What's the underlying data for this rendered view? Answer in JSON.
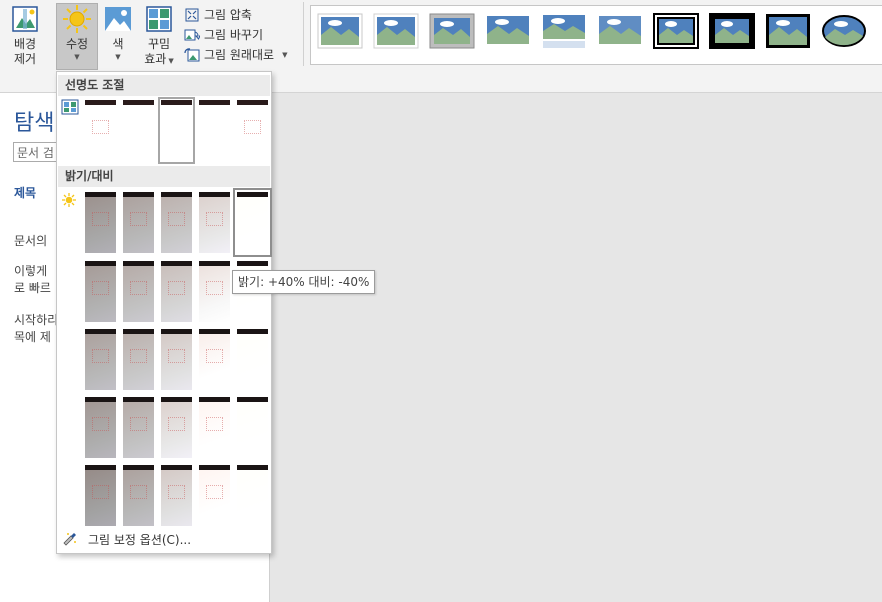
{
  "ribbon": {
    "remove_bg": {
      "line1": "배경",
      "line2": "제거"
    },
    "corrections": {
      "label": "수정"
    },
    "color": {
      "label": "색"
    },
    "artistic": {
      "line1": "꾸밈",
      "line2": "효과"
    },
    "compress": "그림 압축",
    "change": "그림 바꾸기",
    "reset": "그림 원래대로"
  },
  "nav": {
    "title": "탐색",
    "search_placeholder": "문서 검",
    "tab": "제목",
    "text1": "문서의",
    "text2a": "이렇게",
    "text2b": "로 빠르",
    "text3a": "시작하리",
    "text3b": "목에 제"
  },
  "dropdown": {
    "sharpen_header": "선명도 조절",
    "brightness_header": "밝기/대비",
    "options": "그림 보정 옵션(C)...",
    "tooltip": "밝기: +40% 대비: -40%"
  },
  "colors": {
    "accent": "#2b579a",
    "sun": "#f5c518"
  },
  "sharpen_levels": [
    0.02,
    0.0,
    0.0,
    0.0,
    0.03
  ],
  "brightness_grid": [
    [
      0.3,
      0.4,
      0.5,
      0.7,
      1.0
    ],
    [
      0.36,
      0.46,
      0.58,
      0.8,
      1.0
    ],
    [
      0.4,
      0.5,
      0.65,
      0.88,
      1.0
    ],
    [
      0.34,
      0.46,
      0.7,
      0.93,
      1.0
    ],
    [
      0.26,
      0.4,
      0.65,
      0.93,
      1.0
    ]
  ]
}
